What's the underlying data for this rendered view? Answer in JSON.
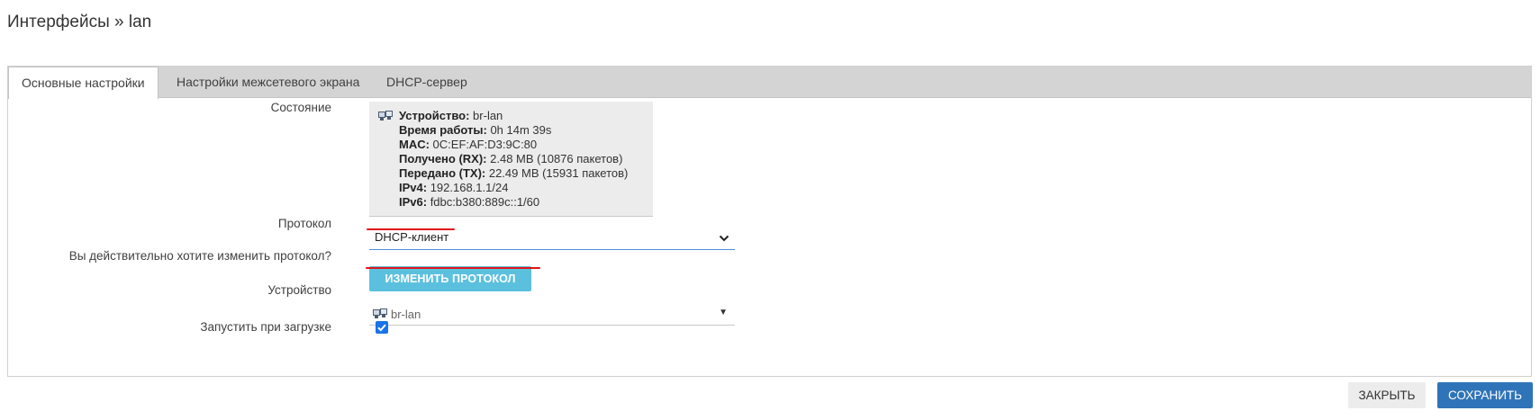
{
  "page": {
    "title": "Интерфейсы » lan"
  },
  "tabs": [
    {
      "label": "Основные настройки",
      "active": true
    },
    {
      "label": "Настройки межсетевого экрана",
      "active": false
    },
    {
      "label": "DHCP-сервер",
      "active": false
    }
  ],
  "status": {
    "label": "Состояние",
    "icon": "network-interface-icon",
    "lines": [
      {
        "key": "Устройство:",
        "value": " br-lan"
      },
      {
        "key": "Время работы:",
        "value": " 0h 14m 39s"
      },
      {
        "key": "MAC:",
        "value": " 0C:EF:AF:D3:9C:80"
      },
      {
        "key": "Получено (RX):",
        "value": " 2.48 MB (10876 пакетов)"
      },
      {
        "key": "Передано (TX):",
        "value": " 22.49 MB (15931 пакетов)"
      },
      {
        "key": "IPv4:",
        "value": " 192.168.1.1/24"
      },
      {
        "key": "IPv6:",
        "value": " fdbc:b380:889c::1/60"
      }
    ]
  },
  "protocol": {
    "label": "Протокол",
    "value": "DHCP-клиент"
  },
  "change_protocol": {
    "label": "Вы действительно хотите изменить протокол?",
    "button": "ИЗМЕНИТЬ ПРОТОКОЛ"
  },
  "device": {
    "label": "Устройство",
    "value": "br-lan",
    "icon": "network-interface-icon"
  },
  "autostart": {
    "label": "Запустить при загрузке",
    "checked": true
  },
  "footer": {
    "close_label": "ЗАКРЫТЬ",
    "save_label": "СОХРАНИТЬ"
  },
  "colors": {
    "primary": "#2f74b8",
    "info": "#5bc0de",
    "annotation": "#e0131a",
    "checkbox": "#1a73e8"
  }
}
